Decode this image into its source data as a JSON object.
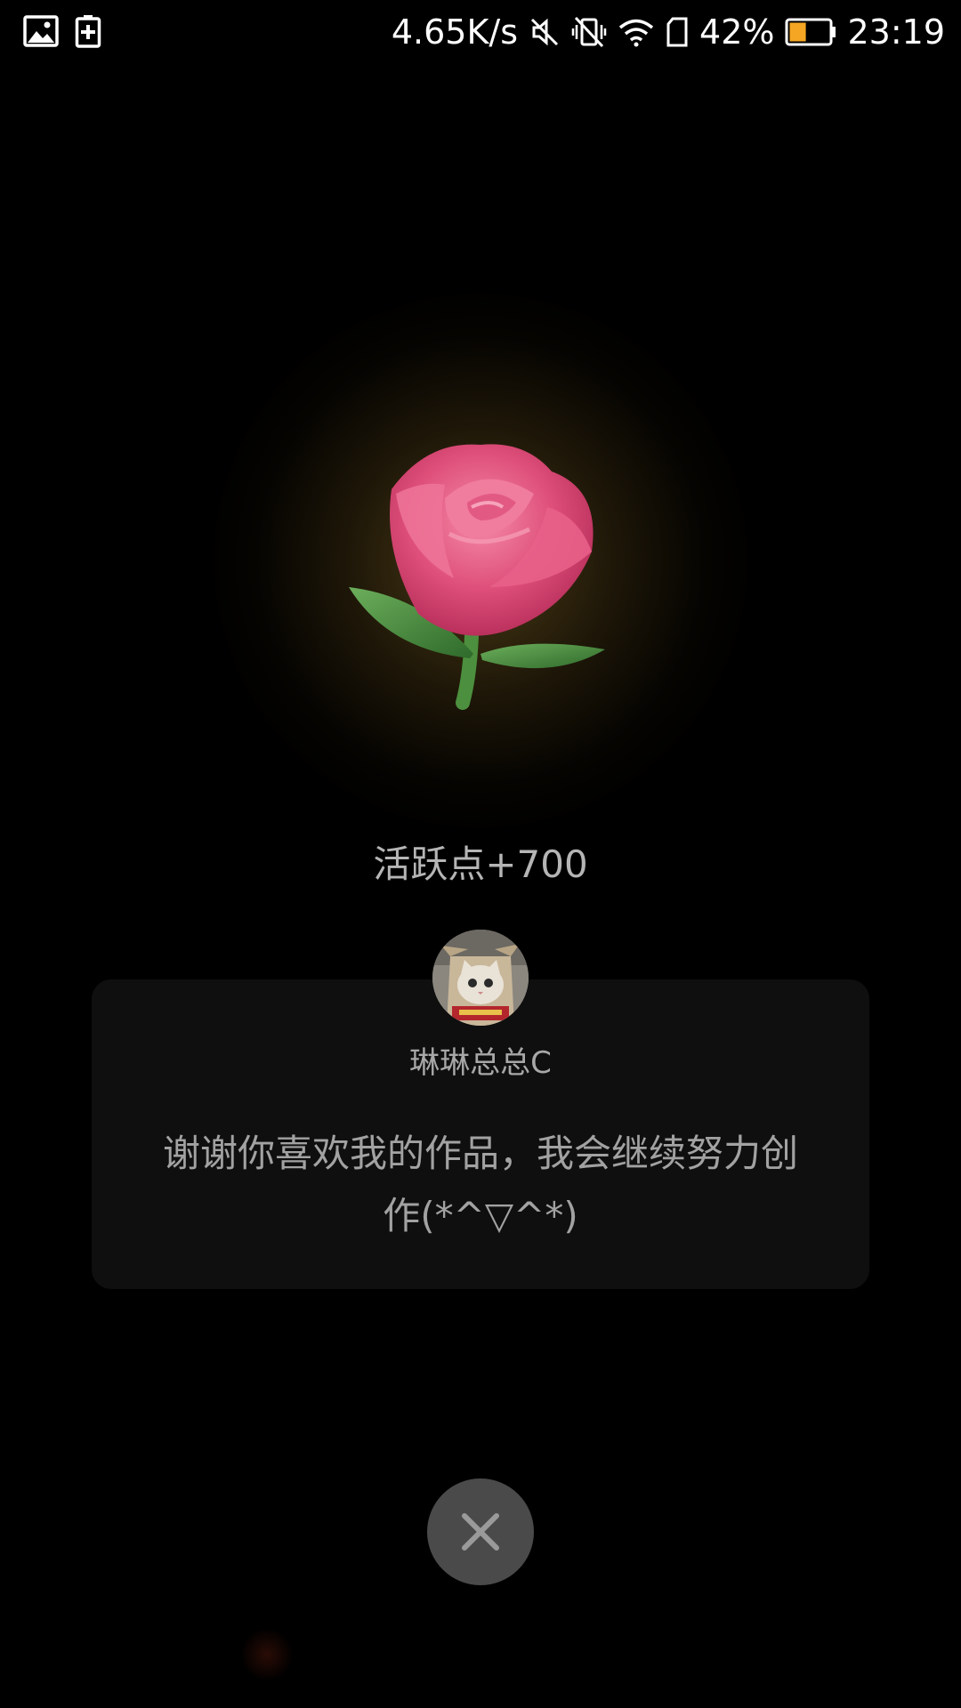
{
  "status_bar": {
    "left_icons": [
      "image-icon",
      "battery-saver-icon"
    ],
    "network_speed": "4.65K/s",
    "icons": [
      "mute-icon",
      "vibrate-off-icon",
      "wifi-icon",
      "sim-icon"
    ],
    "battery_percent_text": "42%",
    "battery_level": 0.42,
    "battery_color": "#f5a623",
    "time": "23:19"
  },
  "gift": {
    "icon": "rose-icon",
    "points_label": "活跃点+700"
  },
  "card": {
    "avatar_icon": "cat-avatar",
    "username": "琳琳总总C",
    "message": "谢谢你喜欢我的作品，我会继续努力创作(*^▽^*)"
  },
  "close_button": {
    "icon": "close-icon"
  }
}
